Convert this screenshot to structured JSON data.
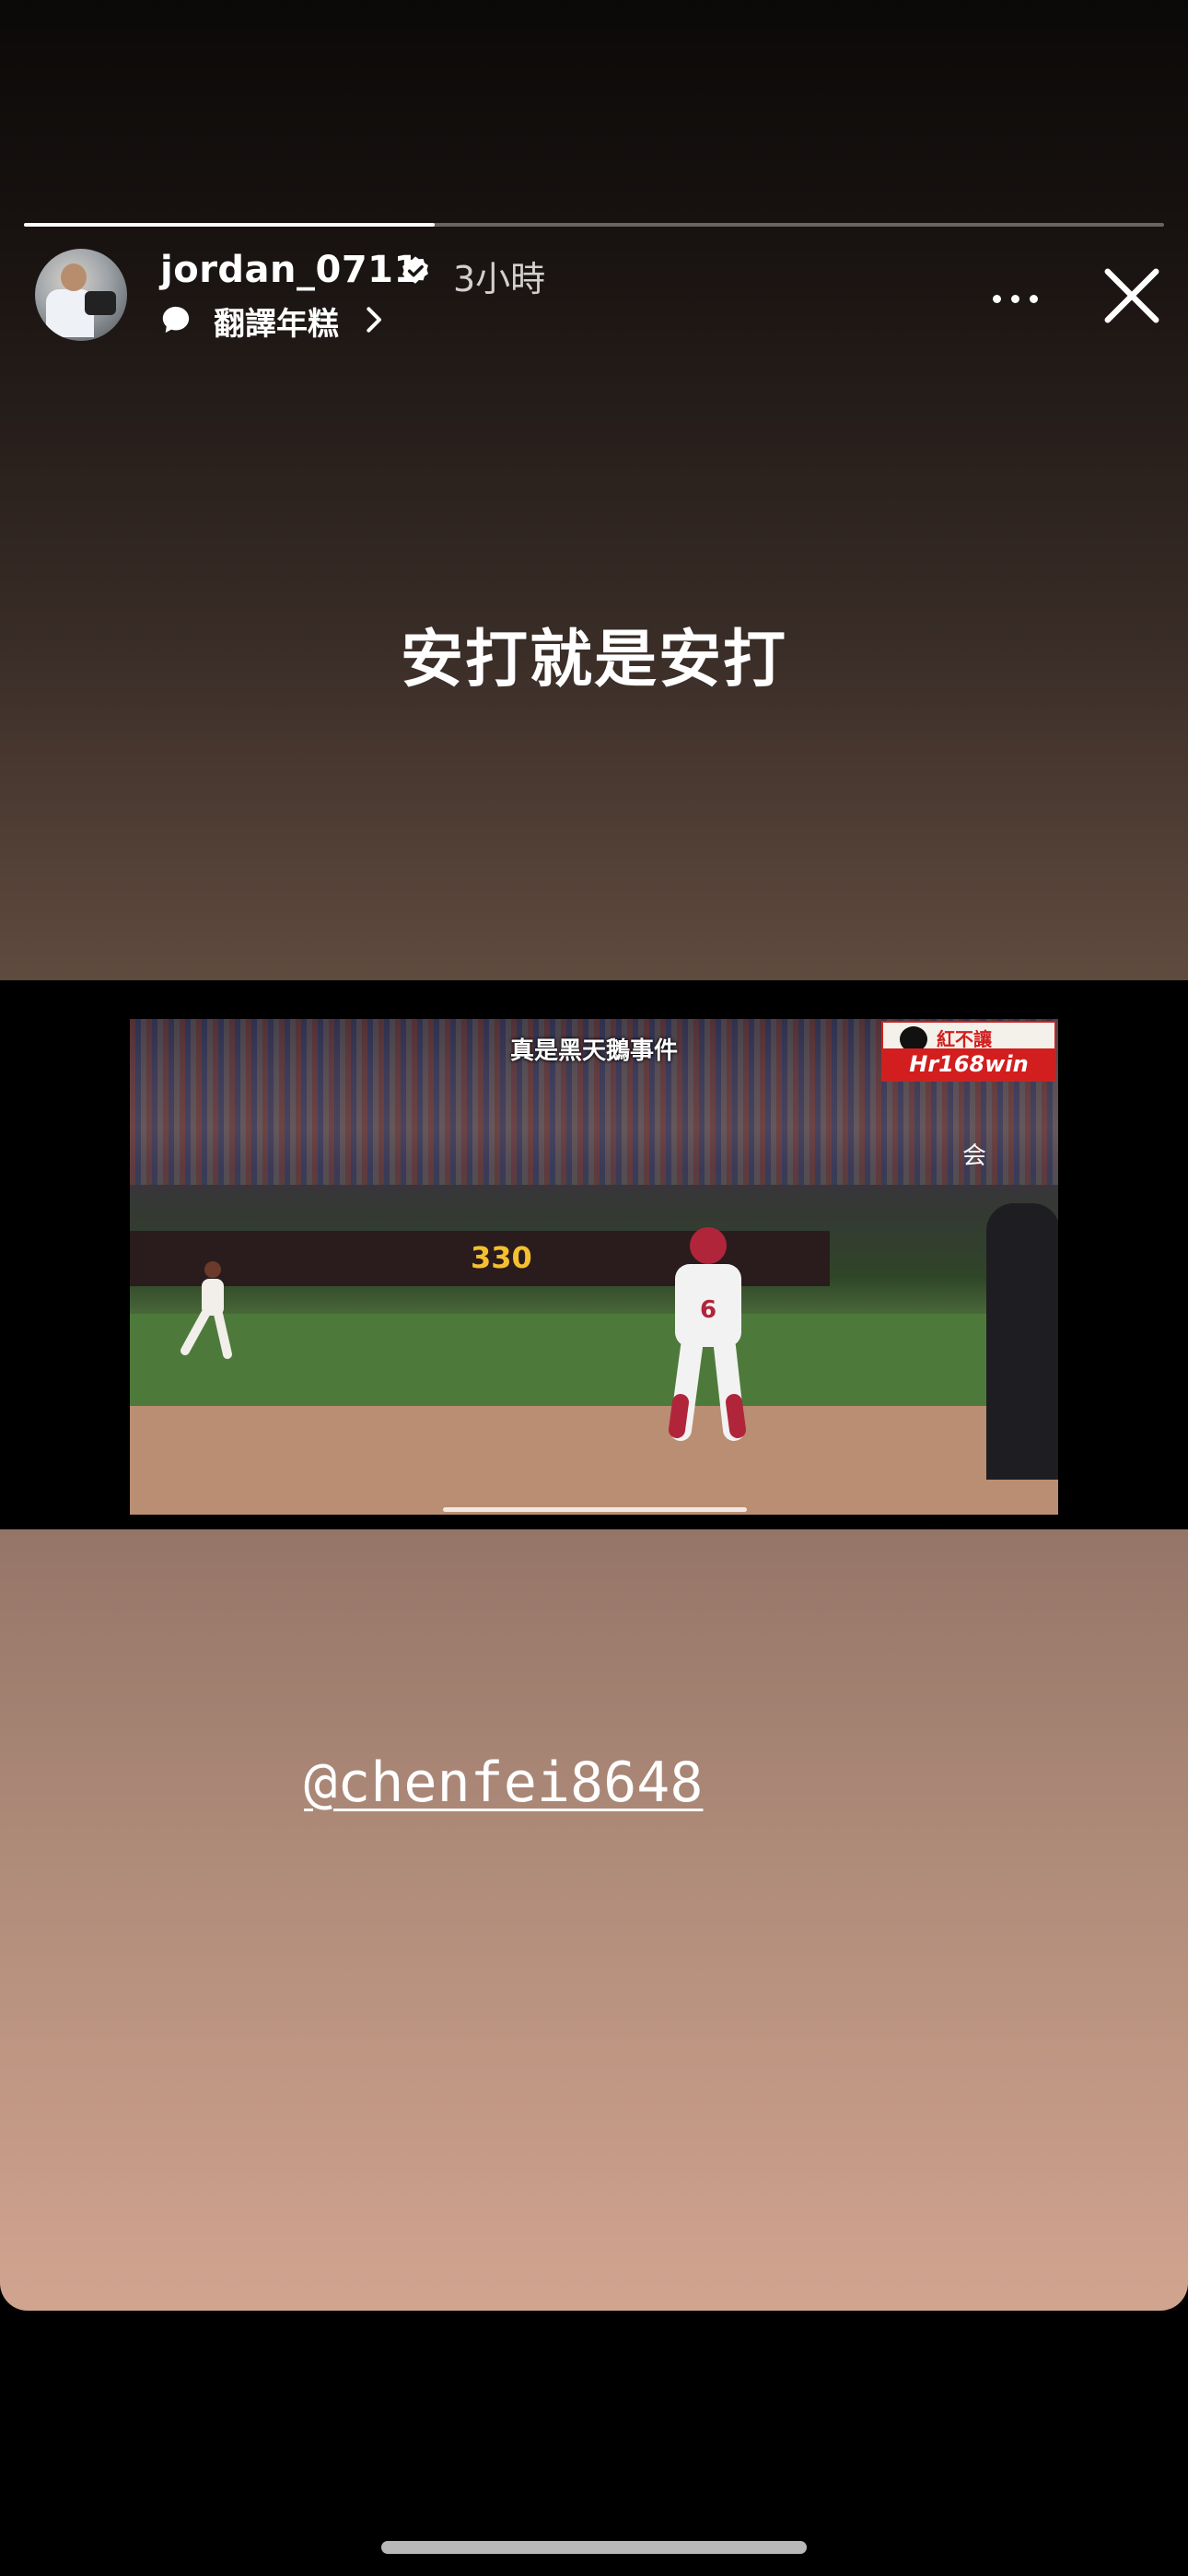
{
  "progress": {
    "fraction": 0.36
  },
  "header": {
    "username": "jordan_0711",
    "verified": true,
    "time": "3小時",
    "song": "翻譯年糕"
  },
  "story": {
    "headline": "安打就是安打",
    "mention": "@chenfei8648"
  },
  "video": {
    "caption": "真是黑天鵝事件",
    "logo_top": "紅不讓",
    "logo_bottom": "Hr168win",
    "corner_char": "会",
    "wall_number": "330",
    "jersey_number": "6"
  },
  "colors": {
    "gradient_top": "#0b0908",
    "gradient_bottom": "#d1a48f",
    "verified_badge": "#ffffff"
  }
}
